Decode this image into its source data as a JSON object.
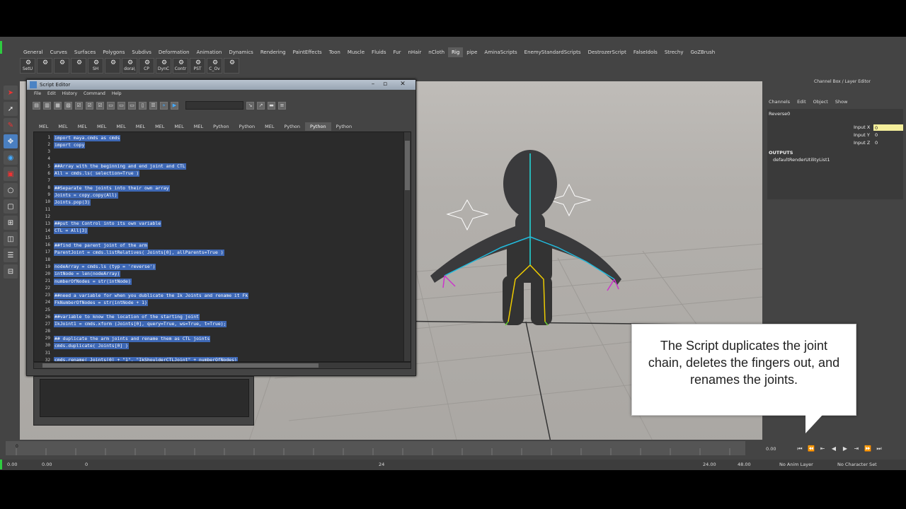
{
  "shelf": {
    "tabs": [
      "General",
      "Curves",
      "Surfaces",
      "Polygons",
      "Subdivs",
      "Deformation",
      "Animation",
      "Dynamics",
      "Rendering",
      "PaintEffects",
      "Toon",
      "Muscle",
      "Fluids",
      "Fur",
      "nHair",
      "nCloth",
      "Rig",
      "pipe",
      "AminaScripts",
      "EnemyStandardScripts",
      "DestrozerScript",
      "FalseIdols",
      "Strechy",
      "GoZBrush"
    ],
    "active_index": 16,
    "icons": [
      "SetU",
      "",
      "",
      "",
      "SH",
      "",
      "dora\\",
      "CP",
      "DynC",
      "Contr",
      "PST",
      "C_Ov",
      ""
    ]
  },
  "script_editor": {
    "title": "Script Editor",
    "menu": [
      "File",
      "Edit",
      "History",
      "Command",
      "Help"
    ],
    "tabs": [
      "MEL",
      "MEL",
      "MEL",
      "MEL",
      "MEL",
      "MEL",
      "MEL",
      "MEL",
      "MEL",
      "Python",
      "Python",
      "MEL",
      "Python",
      "Python",
      "Python"
    ],
    "active_tab_index": 13,
    "lines": [
      "import maya.cmds as cmds",
      "import copy",
      "",
      "",
      "##Array with the beginning and end joint and CTL",
      "All = cmds.ls( selection=True )",
      "",
      "##Separate the joints into their own array",
      "Joints = copy.copy(All)",
      "Joints.pop(3)",
      "",
      "",
      "##put the Control into its own variable",
      "CTL = All[3]",
      "",
      "##find the parent joint of the arm",
      "ParentJoint = cmds.listRelatives( Joints[0], allParents=True )",
      "",
      "nodeArray = cmds.ls (typ = 'reverse')",
      "intNode = len(nodeArray)",
      "numberOfNodes = str(intNode)",
      "",
      "##need a variable for when you dublicate the Ik Joints and rename it Fk",
      "FkNumberOfNodes = str(intNode + 1)",
      "",
      "##variable to know the location of the starting joint",
      "IkJoint1 = cmds.xform (Joints[0], query=True, ws=True, t=True);",
      "",
      "## duplicate the arm joints and rename them as CTL joints",
      "cmds.duplicate( Joints[0] )",
      "",
      "cmds.rename( Joints[0] + \"1\", \"IkShoulderCTLJoint\" + numberOfNodes)"
    ]
  },
  "channel_box": {
    "title": "Channel Box / Layer Editor",
    "menu": [
      "Channels",
      "Edit",
      "Object",
      "Show"
    ],
    "node": "Reverse0",
    "inputs": [
      {
        "label": "Input X",
        "value": "0"
      },
      {
        "label": "Input Y",
        "value": "0"
      },
      {
        "label": "Input Z",
        "value": "0"
      }
    ],
    "outputs_header": "OUTPUTS",
    "output_node": "defaultRenderUtilityList1"
  },
  "callout": {
    "text": "The Script duplicates the joint chain, deletes the fingers out, and renames the joints."
  },
  "timeline": {
    "start_tick": "0",
    "current": "0.00",
    "range_start": "0.00",
    "range_start2": "0.00",
    "range_mid_marker": "0",
    "range_end_marker": "24",
    "end_time": "24.00",
    "end_time2": "48.00",
    "anim_layer": "No Anim Layer",
    "character_set": "No Character Set"
  }
}
